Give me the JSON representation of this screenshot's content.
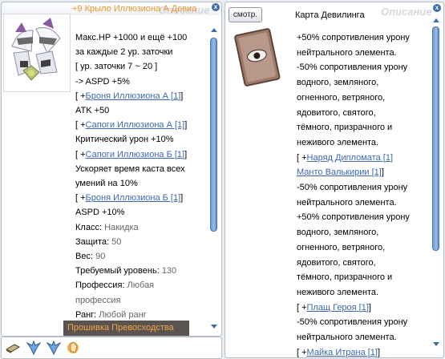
{
  "left_window": {
    "title": "+9 Крыло Иллюзиона А Девиа",
    "watermark": "Описание",
    "close_glyph": "x",
    "lines": [
      [
        {
          "t": "Макс.HP +1000 и ещё +100"
        }
      ],
      [
        {
          "t": "за каждые 2 ур. заточки"
        }
      ],
      [
        {
          "t": "[ ур. заточки 7 ~ 20 ]"
        }
      ],
      [
        {
          "t": " -> ASPD +5%"
        }
      ],
      [
        {
          "t": "[ +"
        },
        {
          "t": "Броня Иллюзиона А [1]",
          "c": "lnk"
        },
        {
          "t": "]"
        }
      ],
      [
        {
          "t": "ATK +50"
        }
      ],
      [
        {
          "t": "[ +"
        },
        {
          "t": "Сапоги Иллюзиона А [1]",
          "c": "lnk"
        },
        {
          "t": "]"
        }
      ],
      [
        {
          "t": "Критический урон +10%"
        }
      ],
      [
        {
          "t": "[ +"
        },
        {
          "t": "Сапоги Иллюзиона Б [1]",
          "c": "lnk"
        },
        {
          "t": "]"
        }
      ],
      [
        {
          "t": "Ускоряет время каста всех"
        }
      ],
      [
        {
          "t": "умений на 10%"
        }
      ],
      [
        {
          "t": "[ +"
        },
        {
          "t": "Броня Иллюзиона Б [1]",
          "c": "lnk"
        },
        {
          "t": "]"
        }
      ],
      [
        {
          "t": "ASPD +10%"
        }
      ],
      [
        {
          "t": "Класс: "
        },
        {
          "t": "Накидка",
          "c": "grey"
        }
      ],
      [
        {
          "t": "Защита: "
        },
        {
          "t": "50",
          "c": "grey"
        }
      ],
      [
        {
          "t": "Вес: "
        },
        {
          "t": "90",
          "c": "grey"
        }
      ],
      [
        {
          "t": "Требуемый уровень: "
        },
        {
          "t": "130",
          "c": "grey"
        }
      ],
      [
        {
          "t": "Профессия: "
        },
        {
          "t": "Любая",
          "c": "grey"
        }
      ],
      [
        {
          "t": "профессия",
          "c": "grey"
        }
      ],
      [
        {
          "t": "Ранг: "
        },
        {
          "t": "Любой ранг",
          "c": "grey"
        }
      ]
    ]
  },
  "tooltip": "Прошивка Превосходства",
  "right_window": {
    "smotr_label": "смотр.",
    "title": "Карта Девилинга",
    "watermark": "Описание",
    "close_glyph": "x",
    "lines": [
      [
        {
          "t": "+50% сопротивления урону"
        }
      ],
      [
        {
          "t": "нейтрального элемента."
        }
      ],
      [
        {
          "t": "-50% сопротивления урону"
        }
      ],
      [
        {
          "t": "водного, земляного,"
        }
      ],
      [
        {
          "t": "огненного, ветряного,"
        }
      ],
      [
        {
          "t": "ядовитого, святого,"
        }
      ],
      [
        {
          "t": "тёмного, призрачного и"
        }
      ],
      [
        {
          "t": "неживого элемента."
        }
      ],
      [
        {
          "t": "[ +"
        },
        {
          "t": "Наряд Дипломата [1]",
          "c": "lnk"
        }
      ],
      [
        {
          "t": "Манто Валькирии [1]",
          "c": "lnk"
        },
        {
          "t": "]"
        }
      ],
      [
        {
          "t": "-50% сопротивления урону"
        }
      ],
      [
        {
          "t": "нейтрального элемента."
        }
      ],
      [
        {
          "t": "+50% сопротивления урону"
        }
      ],
      [
        {
          "t": "водного, земляного,"
        }
      ],
      [
        {
          "t": "огненного, ветряного,"
        }
      ],
      [
        {
          "t": "ядовитого, святого,"
        }
      ],
      [
        {
          "t": "тёмного, призрачного и"
        }
      ],
      [
        {
          "t": "неживого элемента."
        }
      ],
      [
        {
          "t": "[ +"
        },
        {
          "t": "Плащ Героя [1]",
          "c": "lnk"
        },
        {
          "t": "]"
        }
      ],
      [
        {
          "t": "-50% сопротивления урону"
        }
      ],
      [
        {
          "t": "нейтрального элемента."
        }
      ],
      [
        {
          "t": "[ +"
        },
        {
          "t": "Майка Итрана [1]",
          "c": "lnk"
        },
        {
          "t": "]"
        }
      ]
    ]
  },
  "taskbar": {
    "icons": [
      "book-icon",
      "wing-blue-icon",
      "wing-blue-icon",
      "hand-cursor-icon"
    ]
  }
}
